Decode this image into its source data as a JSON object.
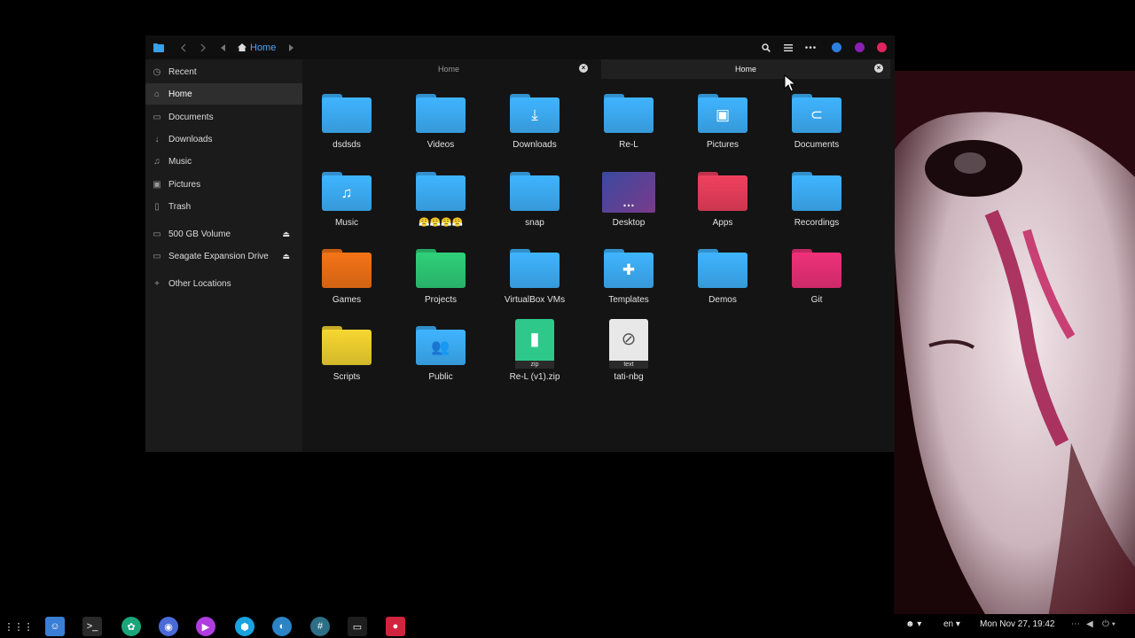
{
  "file_manager": {
    "path_label": "Home",
    "tabs": [
      {
        "label": "Home",
        "active": false
      },
      {
        "label": "Home",
        "active": true
      }
    ],
    "window_colors": {
      "blue": "#2d7fe0",
      "purple": "#8a1fb3",
      "pink": "#e0245e"
    }
  },
  "sidebar": {
    "items": [
      {
        "label": "Recent",
        "icon": "clock-icon"
      },
      {
        "label": "Home",
        "icon": "home-icon",
        "active": true
      },
      {
        "label": "Documents",
        "icon": "document-icon"
      },
      {
        "label": "Downloads",
        "icon": "download-icon"
      },
      {
        "label": "Music",
        "icon": "music-icon"
      },
      {
        "label": "Pictures",
        "icon": "image-icon"
      },
      {
        "label": "Trash",
        "icon": "trash-icon"
      },
      {
        "label": "500 GB Volume",
        "icon": "drive-icon",
        "eject": true
      },
      {
        "label": "Seagate Expansion Drive",
        "icon": "drive-icon",
        "eject": true
      },
      {
        "label": "Other Locations",
        "icon": "plus-icon"
      }
    ]
  },
  "files": [
    {
      "name": "dsdsds",
      "kind": "folder",
      "color": "#3fb4ff",
      "glyph": ""
    },
    {
      "name": "Videos",
      "kind": "folder",
      "color": "#3fb4ff",
      "glyph": ""
    },
    {
      "name": "Downloads",
      "kind": "folder",
      "color": "#3fb4ff",
      "glyph": "download-icon"
    },
    {
      "name": "Re-L",
      "kind": "folder",
      "color": "#3fb4ff",
      "glyph": ""
    },
    {
      "name": "Pictures",
      "kind": "folder",
      "color": "#3fb4ff",
      "glyph": "image-icon"
    },
    {
      "name": "Documents",
      "kind": "folder",
      "color": "#3fb4ff",
      "glyph": "paperclip-icon"
    },
    {
      "name": "Music",
      "kind": "folder",
      "color": "#3fb4ff",
      "glyph": "music-icon"
    },
    {
      "name": "😤😤😤😤",
      "kind": "folder",
      "color": "#3fb4ff",
      "glyph": ""
    },
    {
      "name": "snap",
      "kind": "folder",
      "color": "#3fb4ff",
      "glyph": ""
    },
    {
      "name": "Desktop",
      "kind": "desktop",
      "color": "#5a4a9a",
      "glyph": "dots-icon"
    },
    {
      "name": "Apps",
      "kind": "folder",
      "color": "#f0405e",
      "glyph": ""
    },
    {
      "name": "Recordings",
      "kind": "folder",
      "color": "#3fb4ff",
      "glyph": ""
    },
    {
      "name": "Games",
      "kind": "folder",
      "color": "#f57417",
      "glyph": ""
    },
    {
      "name": "Projects",
      "kind": "folder",
      "color": "#2fd07a",
      "glyph": ""
    },
    {
      "name": "VirtualBox VMs",
      "kind": "folder",
      "color": "#3fb4ff",
      "glyph": ""
    },
    {
      "name": "Templates",
      "kind": "folder",
      "color": "#3fb4ff",
      "glyph": "puzzle-icon"
    },
    {
      "name": "Demos",
      "kind": "folder",
      "color": "#3fb4ff",
      "glyph": ""
    },
    {
      "name": "Git",
      "kind": "folder",
      "color": "#f0317a",
      "glyph": ""
    },
    {
      "name": "Scripts",
      "kind": "folder",
      "color": "#f7d731",
      "glyph": ""
    },
    {
      "name": "Public",
      "kind": "folder",
      "color": "#3fb4ff",
      "glyph": "people-icon"
    },
    {
      "name": "Re-L (v1).zip",
      "kind": "zip",
      "color": "#2ec98a",
      "glyph": "zip-icon",
      "badge": "zip"
    },
    {
      "name": "tati-nbg",
      "kind": "text",
      "color": "#e8e8e8",
      "glyph": "paperclip-icon",
      "badge": "text"
    }
  ],
  "taskbar": {
    "apps": [
      {
        "name": "apps-grid-icon",
        "color": "#000000"
      },
      {
        "name": "finder-icon",
        "color": "#3a7fd5"
      },
      {
        "name": "terminal-icon",
        "color": "#2a2a2a"
      },
      {
        "name": "openai-icon",
        "color": "#19a67a"
      },
      {
        "name": "chromium-icon",
        "color": "#4a6ad8"
      },
      {
        "name": "media-player-icon",
        "color": "#b03de0"
      },
      {
        "name": "box-icon",
        "color": "#1ba3e0"
      },
      {
        "name": "browser-wave-icon",
        "color": "#2b84c6"
      },
      {
        "name": "chat-icon",
        "color": "#2c6f86"
      },
      {
        "name": "console-icon",
        "color": "#1e1e1e"
      },
      {
        "name": "recorder-icon",
        "color": "#d0243e"
      }
    ],
    "language": "en",
    "clock": "Mon Nov 27, 19:42"
  }
}
